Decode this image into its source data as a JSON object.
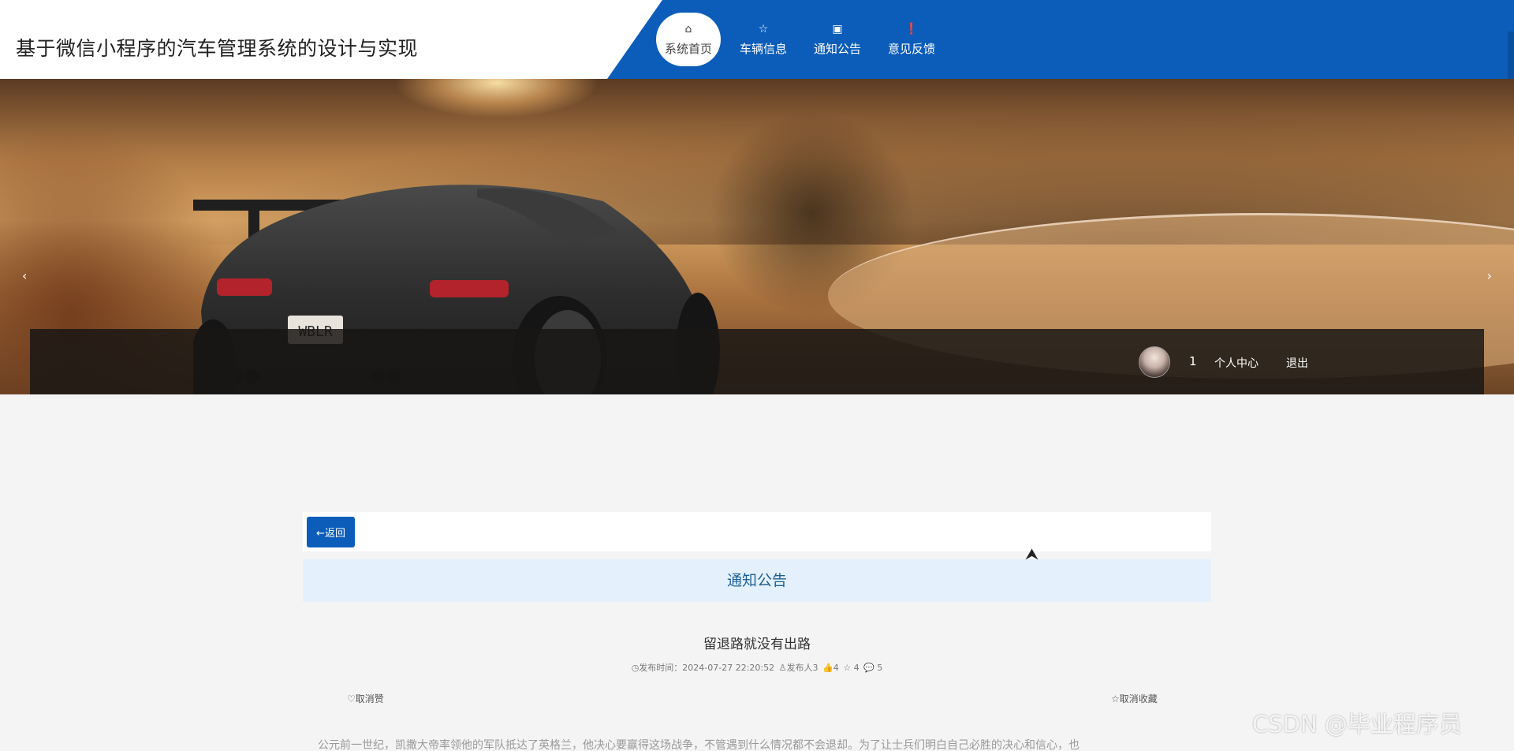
{
  "site": {
    "title": "基于微信小程序的汽车管理系统的设计与实现"
  },
  "nav": {
    "items": [
      {
        "label": "系统首页",
        "icon": "home-icon",
        "glyph": "⌂",
        "active": true
      },
      {
        "label": "车辆信息",
        "icon": "star-icon",
        "glyph": "☆",
        "active": false
      },
      {
        "label": "通知公告",
        "icon": "bag-icon",
        "glyph": "▣",
        "active": false
      },
      {
        "label": "意见反馈",
        "icon": "alert-icon",
        "glyph": "❗",
        "active": false
      }
    ]
  },
  "banner": {
    "prev_glyph": "‹",
    "next_glyph": "›",
    "plate_text": "WBLR"
  },
  "user": {
    "name": "1",
    "center_label": "个人中心",
    "logout_label": "退出"
  },
  "back": {
    "label": "←返回"
  },
  "section": {
    "title": "通知公告"
  },
  "article": {
    "title": "留退路就没有出路",
    "meta": {
      "time_label": "◷发布时间：2024-07-27 22:20:52",
      "author_label": "♙发布人3",
      "likes": "👍4",
      "favs": "☆ 4",
      "comments": "💬 5"
    },
    "like_label": "♡取消赞",
    "fav_label": "☆取消收藏",
    "body": "公元前一世纪，凯撒大帝率领他的军队抵达了英格兰，他决心要赢得这场战争，不管遇到什么情况都不会退却。为了让士兵们明白自己必胜的决心和信心，也"
  },
  "watermark": "CSDN @毕业程序员",
  "colors": {
    "brand": "#0b5db9",
    "section_bg": "#e4f1fc"
  }
}
